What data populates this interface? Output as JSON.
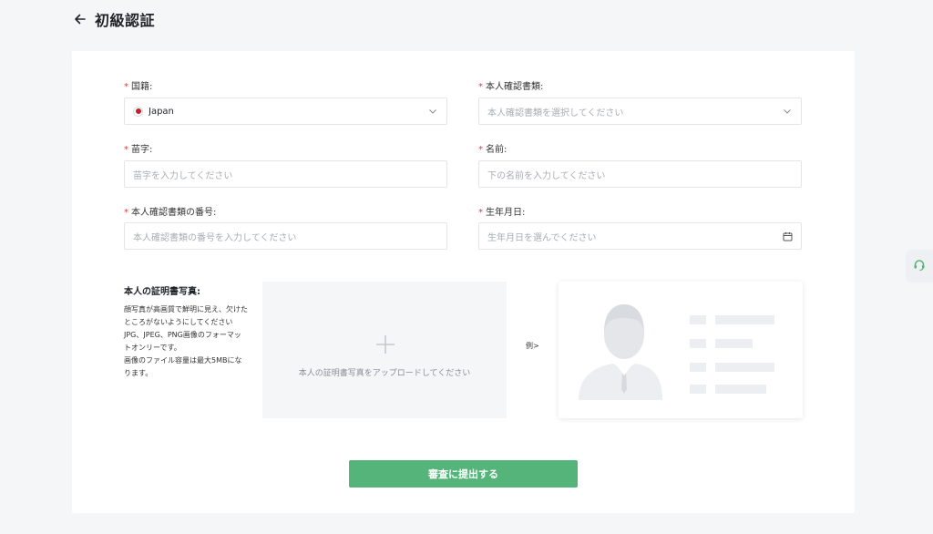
{
  "header": {
    "back_icon": "arrow-left-icon",
    "title": "初級認証"
  },
  "form": {
    "nationality": {
      "label": "国籍:",
      "value": "Japan",
      "flag_icon": "japan-flag-icon"
    },
    "id_type": {
      "label": "本人確認書類:",
      "placeholder": "本人確認書類を選択してください"
    },
    "last_name": {
      "label": "苗字:",
      "placeholder": "苗字を入力してください"
    },
    "first_name": {
      "label": "名前:",
      "placeholder": "下の名前を入力してください"
    },
    "id_number": {
      "label": "本人確認書類の番号:",
      "placeholder": "本人確認書類の番号を入力してください"
    },
    "birth_date": {
      "label": "生年月日:",
      "placeholder": "生年月日を選んでください",
      "icon": "calendar-icon"
    },
    "required_mark": "*"
  },
  "photo": {
    "title": "本人の証明書写真:",
    "description": [
      "顔写真が高画質で鮮明に見え、欠けたところがないようにしてください",
      "JPG、JPEG、PNG画像のフォーマットオンリーです。",
      "画像のファイル容量は最大5MBになります。"
    ],
    "upload_text": "本人の証明書写真をアップロードしてください",
    "example_label": "例>"
  },
  "submit_label": "審査に提出する",
  "colors": {
    "accent": "#55b47a",
    "required": "#e0403a",
    "page_bg": "#f5f6f8"
  }
}
